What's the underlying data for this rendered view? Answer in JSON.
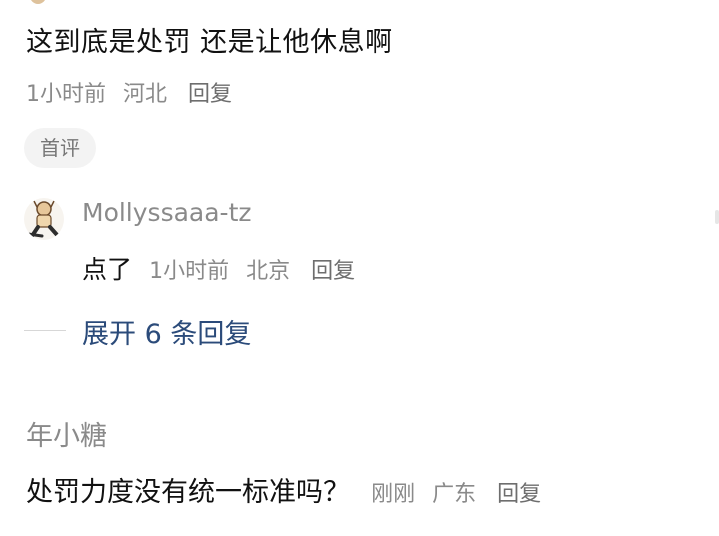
{
  "comment1": {
    "text": "这到底是处罚 还是让他休息啊",
    "time": "1小时前",
    "location": "河北",
    "reply_label": "回复",
    "badge": "首评"
  },
  "reply1": {
    "username": "Mollyssaaa-tz",
    "text": "点了",
    "time": "1小时前",
    "location": "北京",
    "reply_label": "回复"
  },
  "expand_label": "展开 6 条回复",
  "comment2": {
    "username": "年小糖",
    "text": "处罚力度没有统一标准吗？",
    "time": "刚刚",
    "location": "广东",
    "reply_label": "回复"
  },
  "colors": {
    "text_primary": "#111111",
    "text_secondary": "#8a8a8a",
    "link_expand": "#2b4b7a",
    "badge_bg": "#f3f3f3"
  },
  "icons": {
    "avatar": "cartoon-character-avatar"
  }
}
